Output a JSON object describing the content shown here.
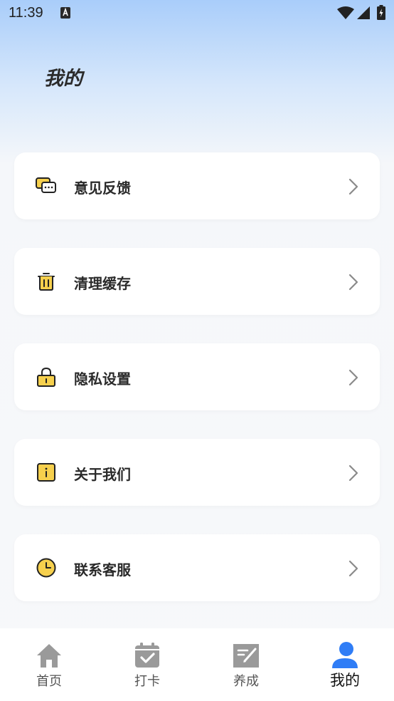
{
  "status_bar": {
    "time": "11:39"
  },
  "header": {
    "title": "我的"
  },
  "menu": {
    "items": [
      {
        "label": "意见反馈",
        "icon": "feedback-icon"
      },
      {
        "label": "清理缓存",
        "icon": "trash-icon"
      },
      {
        "label": "隐私设置",
        "icon": "lock-icon"
      },
      {
        "label": "关于我们",
        "icon": "info-icon"
      },
      {
        "label": "联系客服",
        "icon": "clock-icon"
      }
    ]
  },
  "tab_bar": {
    "tabs": [
      {
        "label": "首页",
        "icon": "home-icon"
      },
      {
        "label": "打卡",
        "icon": "calendar-check-icon"
      },
      {
        "label": "养成",
        "icon": "note-edit-icon"
      },
      {
        "label": "我的",
        "icon": "user-icon"
      }
    ],
    "active_index": 3
  },
  "colors": {
    "accent_yellow": "#f6d04d",
    "active_tab_blue": "#2f7df6",
    "inactive_tab_gray": "#9a9a9a"
  }
}
